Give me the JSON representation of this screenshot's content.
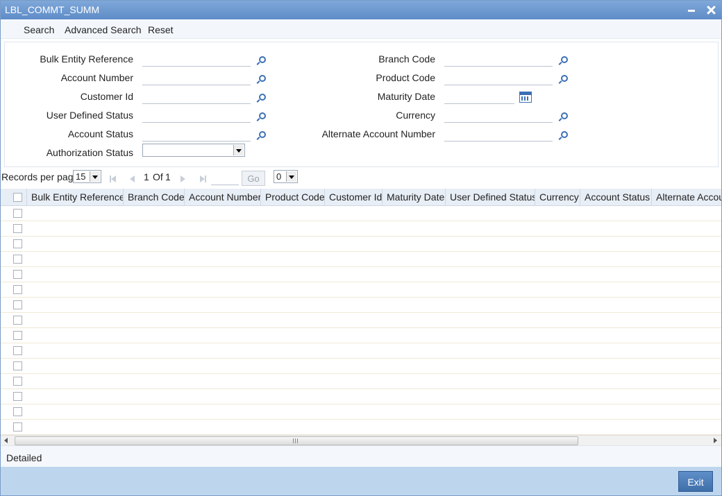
{
  "window": {
    "title": "LBL_COMMT_SUMM"
  },
  "menu": {
    "search": "Search",
    "advanced_search": "Advanced Search",
    "reset": "Reset"
  },
  "form": {
    "bulk_entity_reference": "Bulk Entity Reference",
    "account_number": "Account Number",
    "customer_id": "Customer Id",
    "user_defined_status": "User Defined Status",
    "account_status": "Account Status",
    "authorization_status": "Authorization Status",
    "authorization_status_value": "",
    "branch_code": "Branch Code",
    "product_code": "Product Code",
    "maturity_date": "Maturity Date",
    "currency": "Currency",
    "alternate_account_number": "Alternate Account Number"
  },
  "pager": {
    "records_per_page_label": "Records per page",
    "records_per_page_value": "15",
    "page_current": "1",
    "page_of": "Of",
    "page_total": "1",
    "go_label": "Go",
    "extra_select_value": "0"
  },
  "grid": {
    "columns": [
      "Bulk Entity Reference",
      "Branch Code",
      "Account Number",
      "Product Code",
      "Customer Id",
      "Maturity Date",
      "User Defined Status",
      "Currency",
      "Account Status",
      "Alternate Account Number"
    ],
    "row_count": 15
  },
  "detailed_label": "Detailed",
  "footer": {
    "exit_label": "Exit"
  },
  "colors": {
    "title_bar": "#6f9bd2",
    "footer": "#bdd6ee",
    "accent": "#3b6fb6"
  }
}
